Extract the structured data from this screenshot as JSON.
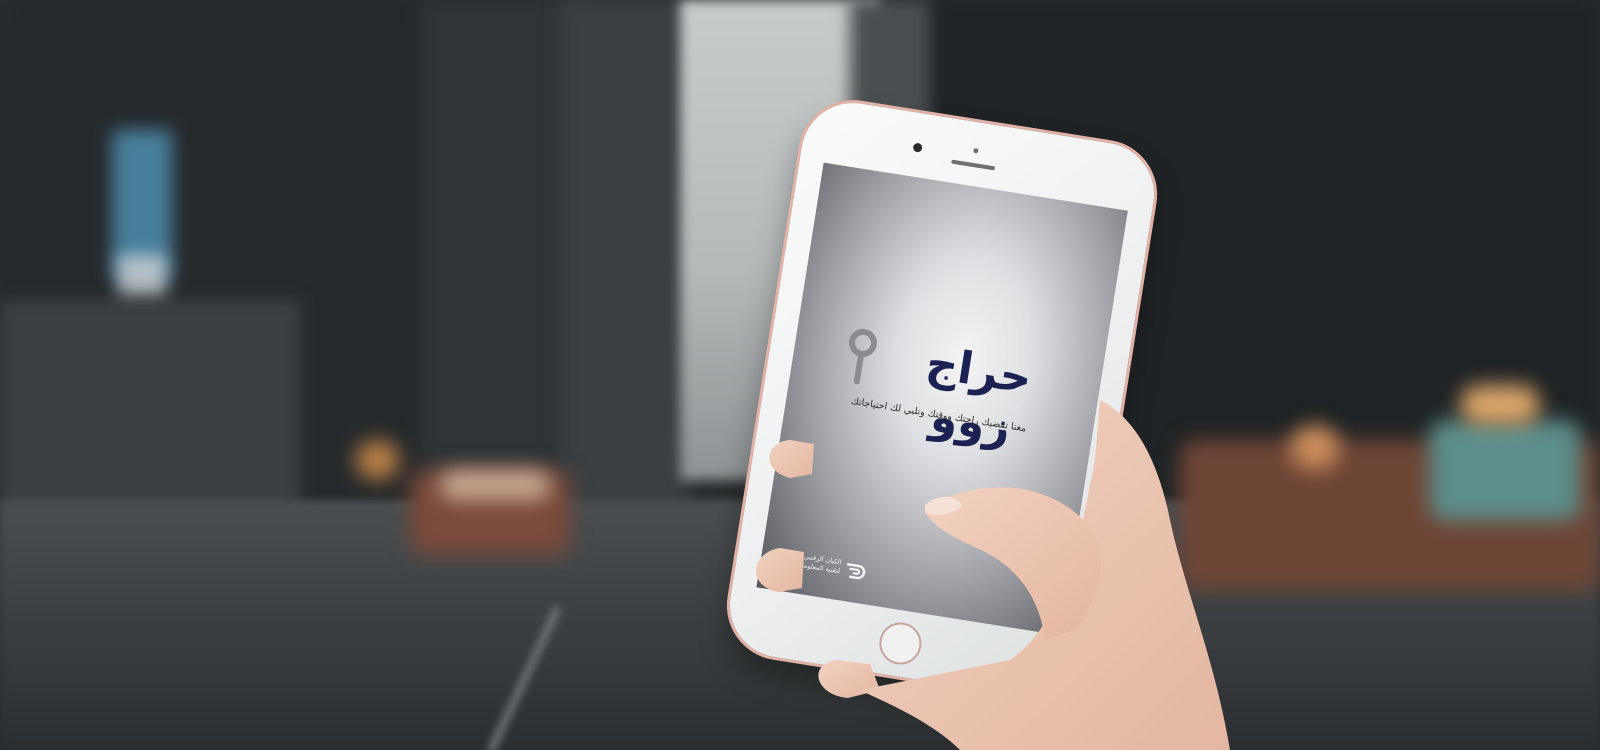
{
  "app": {
    "brand_name": "حراج زوو",
    "tagline": "معنا تقضيك راحتك ووقتك وتلبي لك احتياجاتك",
    "developer_line1": "الكيان الرقمي",
    "developer_line2": "لتقنية المعلومات"
  },
  "colors": {
    "brand_navy": "#1b2152",
    "pin_gray": "#8a8c90",
    "phone_trim": "#e2b2a6"
  },
  "icons": {
    "logo_pin": "location-pin-icon",
    "developer_logo": "developer-logo-icon"
  }
}
